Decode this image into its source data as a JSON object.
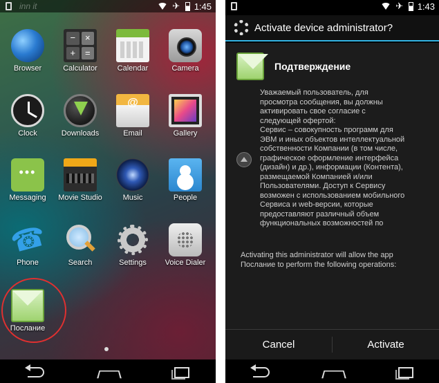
{
  "left": {
    "status": {
      "time": "1:45",
      "ghost_text": "inn it"
    },
    "apps": [
      {
        "label": "Browser",
        "icon": "browser-icon"
      },
      {
        "label": "Calculator",
        "icon": "calculator-icon",
        "glyphs": [
          "−",
          "×",
          "+",
          "="
        ]
      },
      {
        "label": "Calendar",
        "icon": "calendar-icon"
      },
      {
        "label": "Camera",
        "icon": "camera-icon"
      },
      {
        "label": "Clock",
        "icon": "clock-icon"
      },
      {
        "label": "Downloads",
        "icon": "downloads-icon"
      },
      {
        "label": "Email",
        "icon": "email-icon"
      },
      {
        "label": "Gallery",
        "icon": "gallery-icon"
      },
      {
        "label": "Messaging",
        "icon": "messaging-icon"
      },
      {
        "label": "Movie Studio",
        "icon": "movie-studio-icon"
      },
      {
        "label": "Music",
        "icon": "music-icon"
      },
      {
        "label": "People",
        "icon": "people-icon"
      },
      {
        "label": "Phone",
        "icon": "phone-icon"
      },
      {
        "label": "Search",
        "icon": "search-icon"
      },
      {
        "label": "Settings",
        "icon": "settings-icon"
      },
      {
        "label": "Voice Dialer",
        "icon": "voice-dialer-icon"
      },
      {
        "label": "Послание",
        "icon": "envelope-icon"
      }
    ]
  },
  "right": {
    "status": {
      "time": "1:43"
    },
    "dialog_title": "Activate device administrator?",
    "app_name": "Подтверждение",
    "description": "Уважаемый пользователь, для\nпросмотра сообщения, вы должны\nактивировать свое согласие с\nследующей офертой:\nСервис – совокупность программ для\nЭВМ и иных объектов интеллектуальной\nсобственности Компании (в том числе,\nграфическое оформление интерфейса\n(дизайн) и др.), информации (Контента),\nразмещаемой Компанией и/или\nПользователями. Доступ к Сервису\nвозможен с использованием мобильного\nСервиса и web-версии, которые\nпредоставляют различный объем\nфункциональных возможностей по",
    "warning": "Activating this administrator will allow the app\nПослание to perform the following operations:",
    "cancel_label": "Cancel",
    "activate_label": "Activate"
  },
  "colors": {
    "accent": "#33b5e5",
    "highlight": "#e03030"
  }
}
